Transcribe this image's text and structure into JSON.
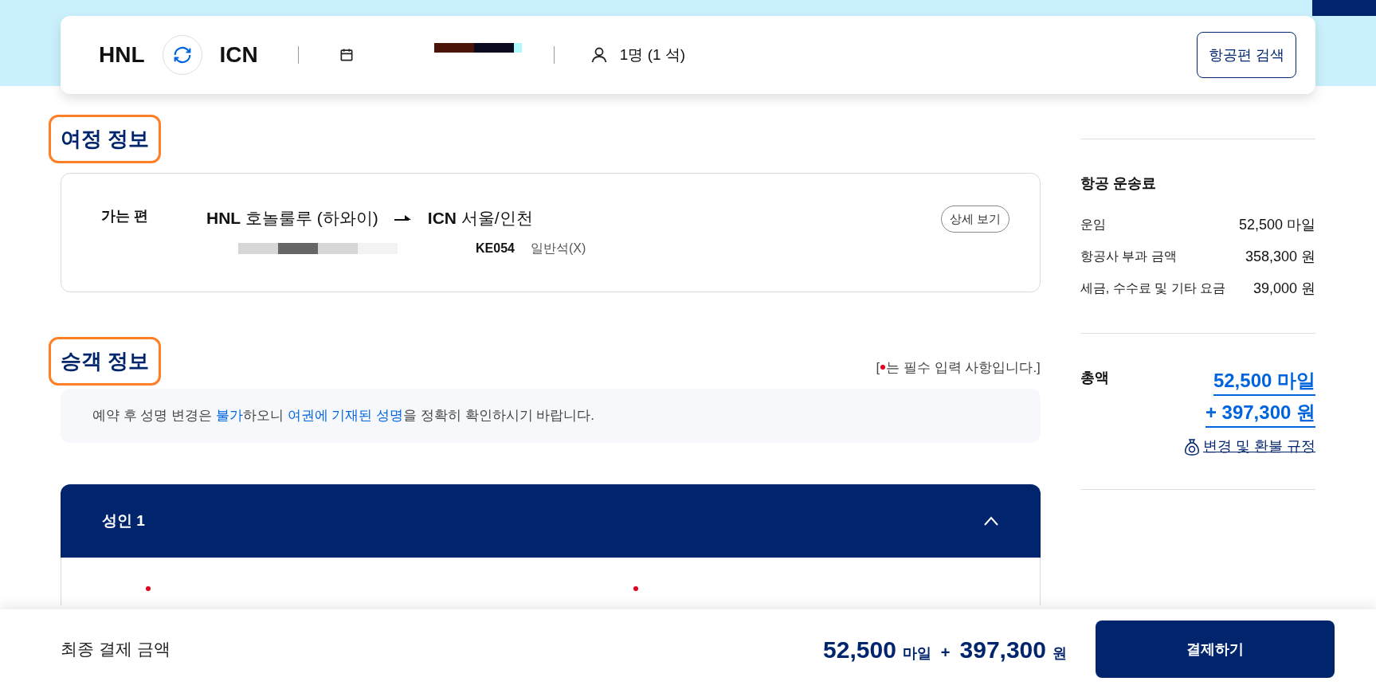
{
  "search_bar": {
    "origin": "HNL",
    "destination": "ICN",
    "passengers": "1명 (1 석)",
    "search_button": "항공편 검색"
  },
  "itinerary": {
    "title": "여정 정보",
    "highlighted": true,
    "flights": [
      {
        "label": "가는 편",
        "origin_code": "HNL",
        "origin_city": "호놀룰루 (하와이)",
        "destination_code": "ICN",
        "destination_city": "서울/인천",
        "flight_number": "KE054",
        "cabin": "일반석(X)",
        "details_button": "상세 보기"
      }
    ]
  },
  "passengers": {
    "title": "승객 정보",
    "highlighted": true,
    "required_note_before": "[ ",
    "required_note_after": "는 필수 입력 사항입니다.]",
    "notice": "예약 후 성명 변경은 **불가**하오니 **여권에 기재된 성명**을 정확히 확인하시기 바랍니다.",
    "panels": [
      {
        "title": "성인 1",
        "expanded": true
      }
    ]
  },
  "fare": {
    "title": "항공 운송료",
    "rows": [
      {
        "label": "운임",
        "value": "52,500 마일"
      },
      {
        "label": "항공사 부과 금액",
        "value": "358,300 원"
      },
      {
        "label": "세금, 수수료 및 기타 요금",
        "value": "39,000 원"
      }
    ],
    "total_label": "총액",
    "total_miles": "52,500 마일",
    "total_won": "+ 397,300 원",
    "rules_link": "변경 및 환불 규정"
  },
  "footer": {
    "label": "최종 결제 금액",
    "miles_amount": "52,500",
    "miles_unit": "마일",
    "plus": "+",
    "won_amount": "397,300",
    "won_unit": "원",
    "pay_button": "결제하기"
  }
}
